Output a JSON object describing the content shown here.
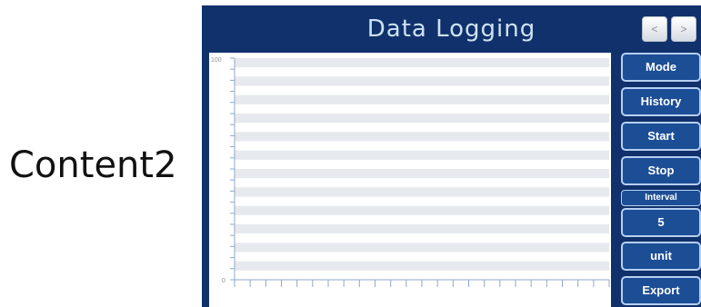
{
  "outer_label": "Content2",
  "header": {
    "title": "Data Logging",
    "prev_label": "<",
    "next_label": ">"
  },
  "buttons": {
    "mode": "Mode",
    "history": "History",
    "start": "Start",
    "stop": "Stop",
    "unit": "unit",
    "export": "Export"
  },
  "interval": {
    "label": "Interval",
    "value": "5"
  },
  "colors": {
    "panel_bg": "#10316b",
    "title_text": "#cde2f7",
    "button_bg": "#1c4e96",
    "button_border": "#b7cff0",
    "chart_stripe": "#e6e9ee",
    "axis": "#8fa8cc"
  },
  "chart_data": {
    "type": "line",
    "title": "",
    "xlabel": "",
    "ylabel": "",
    "ylim": [
      0,
      100
    ],
    "y_tick_labels": [
      "100",
      "0"
    ],
    "series": [],
    "grid": true
  }
}
